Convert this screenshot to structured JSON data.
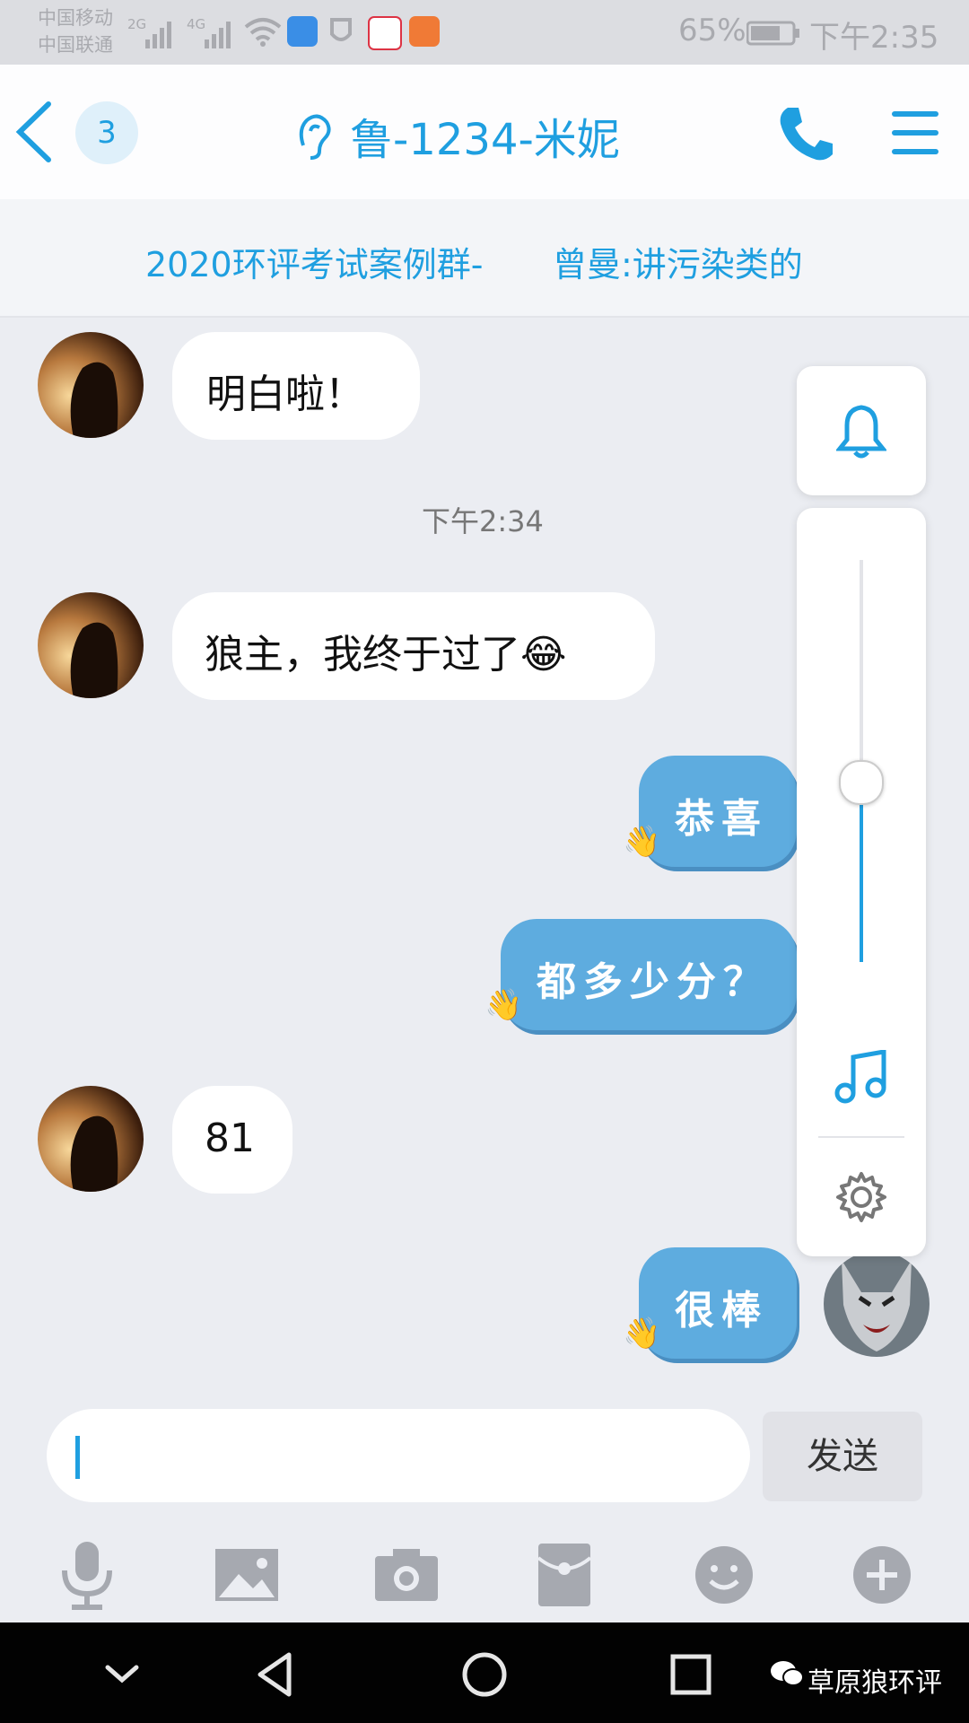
{
  "status_bar": {
    "carrier_1": "中国移动",
    "carrier_2": "中国联通",
    "net_1": "2G",
    "net_2": "4G",
    "battery": "65%",
    "time": "下午2:35"
  },
  "header": {
    "unread_count": "3",
    "title": "鲁-1234-米妮"
  },
  "banner": {
    "group_name": "2020环评考试案例群-",
    "preview": "曾曼:讲污染类的"
  },
  "messages": [
    {
      "side": "in",
      "text": "明白啦！"
    },
    {
      "type": "time",
      "text": "下午2:34"
    },
    {
      "side": "in",
      "text": "狼主，我终于过了😂"
    },
    {
      "side": "out",
      "text": "恭喜"
    },
    {
      "side": "out",
      "text": "都多少分？"
    },
    {
      "side": "in",
      "text": "81"
    },
    {
      "side": "out",
      "text": "很棒"
    }
  ],
  "volume_panel": {
    "level": 0.45
  },
  "composer": {
    "placeholder": "",
    "send_label": "发送"
  },
  "toolbar_icons": [
    "microphone-icon",
    "image-icon",
    "camera-icon",
    "red-packet-icon",
    "emoji-icon",
    "plus-icon"
  ],
  "watermark": "草原狼环评",
  "colors": {
    "accent": "#1f9fe0",
    "out_bubble": "#5eacdf"
  }
}
